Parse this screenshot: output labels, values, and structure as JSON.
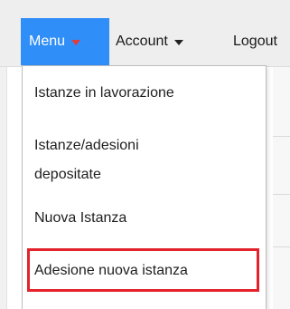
{
  "navbar": {
    "menu_label": "Menu",
    "account_label": "Account",
    "logout_label": "Logout"
  },
  "dropdown": {
    "items": [
      {
        "label": "Istanze in lavorazione"
      },
      {
        "label_line1": "Istanze/adesioni",
        "label_line2": "depositate"
      },
      {
        "label": "Nuova Istanza"
      },
      {
        "label": "Adesione nuova istanza",
        "highlighted": true
      }
    ]
  },
  "colors": {
    "active_menu_bg": "#2f8ef7",
    "highlight_border": "#e3222b",
    "active_caret": "#e23c3c"
  },
  "icons": {
    "menu_caret": "caret-down-icon",
    "account_caret": "caret-down-icon"
  }
}
